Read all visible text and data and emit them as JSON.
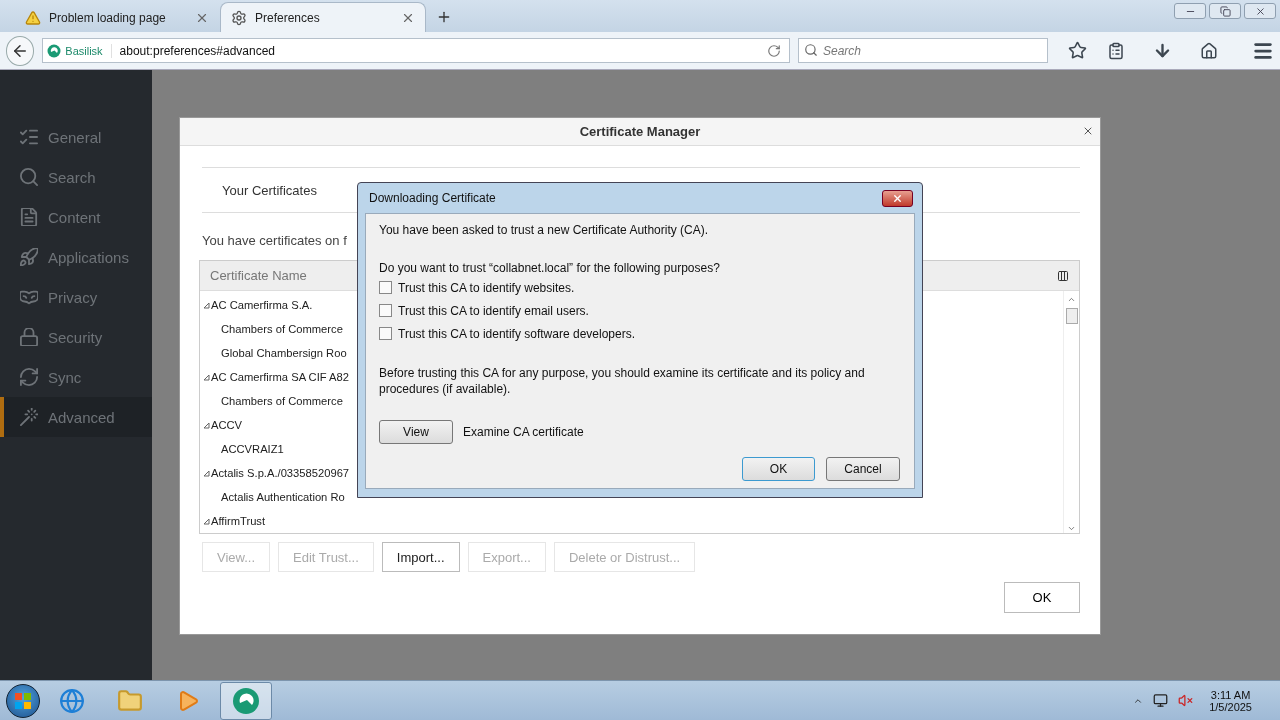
{
  "tabs": [
    {
      "title": "Problem loading page",
      "kind": "warning",
      "selected": false
    },
    {
      "title": "Preferences",
      "kind": "settings",
      "selected": true
    }
  ],
  "nav": {
    "identity": "Basilisk",
    "url": "about:preferences#advanced",
    "search": {
      "placeholder": "Search"
    }
  },
  "sidebar": {
    "items": [
      {
        "label": "General",
        "selected": false
      },
      {
        "label": "Search",
        "selected": false
      },
      {
        "label": "Content",
        "selected": false
      },
      {
        "label": "Applications",
        "selected": false
      },
      {
        "label": "Privacy",
        "selected": false
      },
      {
        "label": "Security",
        "selected": false
      },
      {
        "label": "Sync",
        "selected": false
      },
      {
        "label": "Advanced",
        "selected": true
      }
    ]
  },
  "certificate_manager": {
    "title": "Certificate Manager",
    "tab": "Your Certificates",
    "intro": "You have certificates on f",
    "column": "Certificate Name",
    "rows": [
      {
        "label": "AC Camerfirma S.A.",
        "expanded": true,
        "children": [
          {
            "label": "Chambers of Commerce"
          },
          {
            "label": "Global Chambersign Roo"
          }
        ]
      },
      {
        "label": "AC Camerfirma SA CIF A82",
        "expanded": true,
        "children": [
          {
            "label": "Chambers of Commerce"
          }
        ]
      },
      {
        "label": "ACCV",
        "expanded": true,
        "children": [
          {
            "label": "ACCVRAIZ1"
          }
        ]
      },
      {
        "label": "Actalis S.p.A./03358520967",
        "expanded": true,
        "children": [
          {
            "label": "Actalis Authentication Ro"
          }
        ]
      },
      {
        "label": "AffirmTrust",
        "expanded": true
      }
    ],
    "buttons": [
      {
        "label": "View...",
        "disabled": true
      },
      {
        "label": "Edit Trust...",
        "disabled": true
      },
      {
        "label": "Import...",
        "disabled": false
      },
      {
        "label": "Export...",
        "disabled": true
      },
      {
        "label": "Delete or Distrust...",
        "disabled": true
      }
    ],
    "ok": "OK"
  },
  "dialog": {
    "title": "Downloading Certificate",
    "message": "You have been asked to trust a new Certificate Authority (CA).",
    "question": "Do you want to trust “collabnet.local” for the following purposes?",
    "options": [
      {
        "label": "Trust this CA to identify websites.",
        "checked": false
      },
      {
        "label": "Trust this CA to identify email users.",
        "checked": false
      },
      {
        "label": "Trust this CA to identify software developers.",
        "checked": false
      }
    ],
    "warning": "Before trusting this CA for any purpose, you should examine its certificate and its policy and procedures (if available).",
    "view_button": "View",
    "view_hint": "Examine CA certificate",
    "ok": "OK",
    "cancel": "Cancel"
  },
  "taskbar": {
    "apps": [
      {
        "selected": false
      },
      {
        "selected": false
      },
      {
        "selected": false
      },
      {
        "selected": true
      }
    ],
    "time": "3:11 AM",
    "date": "1/5/2025"
  }
}
